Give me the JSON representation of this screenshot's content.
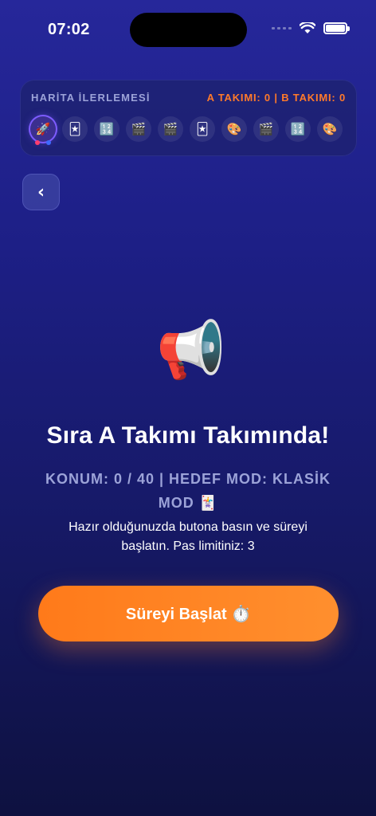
{
  "status_bar": {
    "time": "07:02"
  },
  "progress": {
    "title": "HARİTA İLERLEMESİ",
    "score": "A TAKIMI: 0 | B TAKIMI: 0",
    "steps": [
      {
        "icon": "🚀",
        "name": "rocket-icon",
        "active": true
      },
      {
        "icon": "🃏",
        "name": "card-icon"
      },
      {
        "icon": "🔢",
        "name": "numbers-icon"
      },
      {
        "icon": "🎬",
        "name": "clapper-icon"
      },
      {
        "icon": "🎬",
        "name": "clapper-icon"
      },
      {
        "icon": "🃏",
        "name": "card-icon"
      },
      {
        "icon": "🎨",
        "name": "palette-icon"
      },
      {
        "icon": "🎬",
        "name": "clapper-icon"
      },
      {
        "icon": "🔢",
        "name": "numbers-icon"
      },
      {
        "icon": "🎨",
        "name": "palette-icon"
      }
    ],
    "team_colors": {
      "a": "#ff3d6e",
      "b": "#3d6bff"
    }
  },
  "back_button": {
    "label": "‹",
    "icon": "chevron-left-icon"
  },
  "hero_icon": {
    "glyph": "📢",
    "name": "megaphone-icon"
  },
  "turn": {
    "title": "Sıra A Takımı Takımında!",
    "position": "KONUM: 0 / 40 | HEDEF MOD: KLASİK MOD 🃏",
    "info": "Hazır olduğunuzda butona basın ve süreyi başlatın. Pas limitiniz: 3"
  },
  "start_button": {
    "label": "Süreyi Başlat ⏱️"
  },
  "colors": {
    "accent": "#ff7a1a",
    "score": "#ff7a2a",
    "muted": "#9ca3d8",
    "background": "#1d1f86"
  }
}
